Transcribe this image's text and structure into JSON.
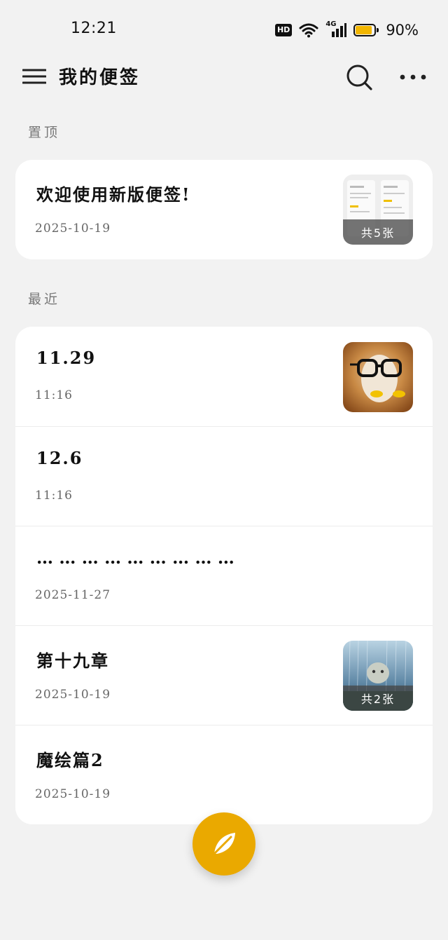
{
  "status_bar": {
    "time": "12:21",
    "hd_label": "HD",
    "network": "4G",
    "battery_text": "90%",
    "battery_level": 0.9,
    "icons": [
      "hd-badge",
      "wifi-icon",
      "signal-4g-icon",
      "battery-icon"
    ]
  },
  "header": {
    "title": "我的便签",
    "icons": [
      "menu-icon",
      "search-icon",
      "more-icon"
    ]
  },
  "sections": {
    "pinned_label": "置顶",
    "recent_label": "最近"
  },
  "pinned_notes": [
    {
      "title": "欢迎使用新版便签!",
      "date": "2025-10-19",
      "thumbnail": "app-screenshots",
      "image_count_label": "共5张"
    }
  ],
  "recent_notes": [
    {
      "title": "11.29",
      "date": "11:16",
      "thumbnail": "cat-with-glasses"
    },
    {
      "title": "12.6",
      "date": "11:16"
    },
    {
      "title": "… … … … … … … … …",
      "date": "2025-11-27"
    },
    {
      "title": "第十九章",
      "date": "2025-10-19",
      "thumbnail": "rainy-face",
      "image_count_label": "共2张"
    },
    {
      "title": "魔绘篇2",
      "date": "2025-10-19"
    }
  ],
  "fab": {
    "icon": "leaf-pen-icon"
  },
  "colors": {
    "accent": "#eaa900",
    "battery": "#f2b600",
    "background": "#f2f2f2",
    "card": "#ffffff"
  }
}
